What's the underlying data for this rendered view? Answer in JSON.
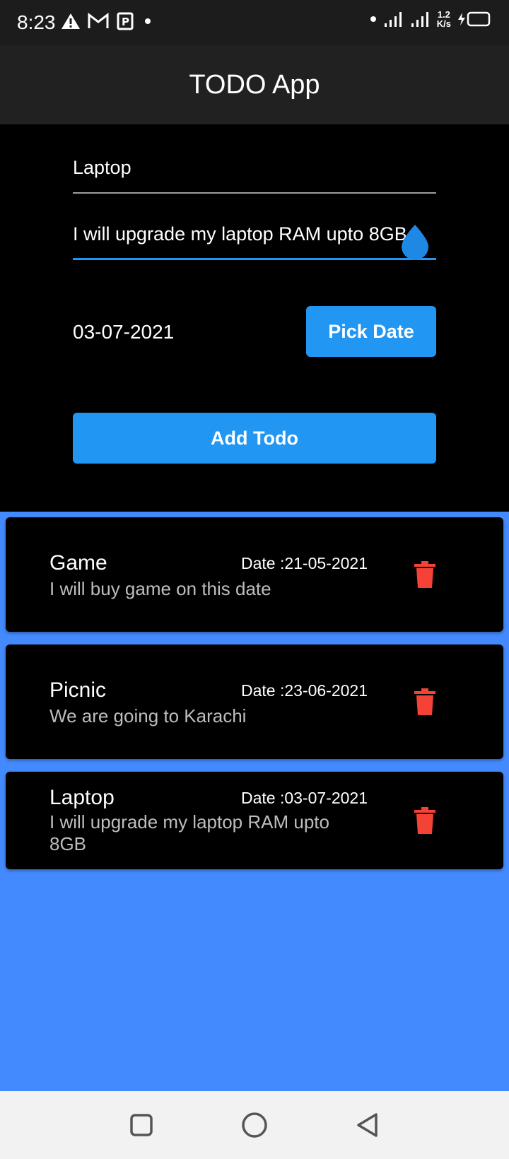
{
  "status_bar": {
    "time": "8:23",
    "net_speed_value": "1.2",
    "net_speed_unit": "K/s"
  },
  "app_bar": {
    "title": "TODO App"
  },
  "form": {
    "title_value": "Laptop",
    "description_value": "I will upgrade my laptop RAM upto 8GB",
    "selected_date": "03-07-2021",
    "pick_date_label": "Pick Date",
    "add_todo_label": "Add Todo"
  },
  "todos": [
    {
      "title": "Game",
      "date": "Date :21-05-2021",
      "description": "I will buy game on this date"
    },
    {
      "title": "Picnic",
      "date": "Date :23-06-2021",
      "description": "We are going to Karachi"
    },
    {
      "title": "Laptop",
      "date": "Date :03-07-2021",
      "description": "I will upgrade my laptop RAM upto 8GB"
    }
  ],
  "colors": {
    "accent": "#2196f3",
    "list_background": "#448aff",
    "delete_icon": "#f44336"
  },
  "icons": [
    "warning-icon",
    "gmail-icon",
    "parking-icon",
    "signal-icon",
    "battery-charging-icon",
    "delete-icon",
    "recent-apps-icon",
    "home-icon",
    "back-icon"
  ]
}
